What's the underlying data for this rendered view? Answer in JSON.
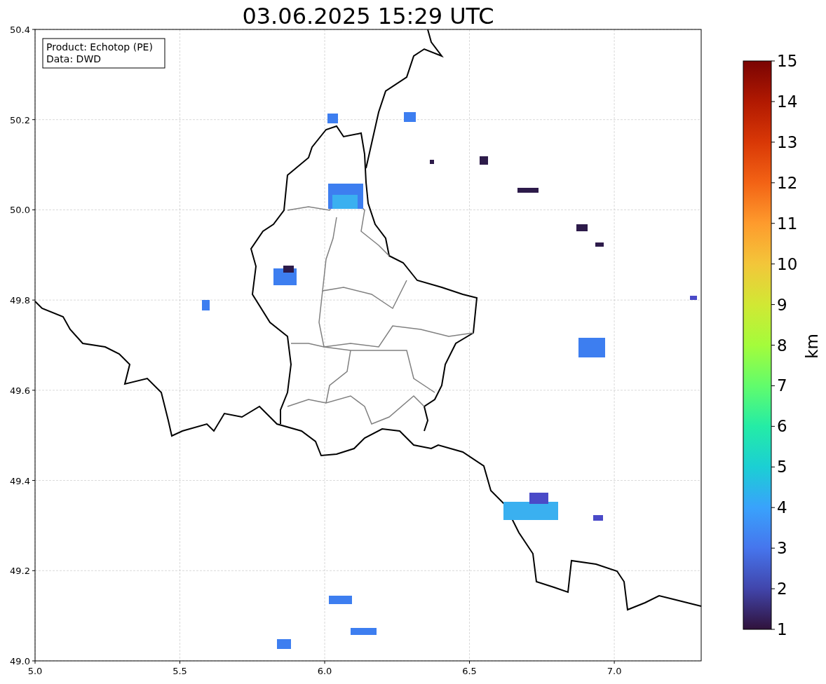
{
  "figure": {
    "title": "03.06.2025 15:29 UTC",
    "info_box": [
      "Product: Echotop (PE)",
      "Data: DWD"
    ],
    "xticks": [
      "5.0",
      "5.5",
      "6.0",
      "6.5",
      "7.0"
    ],
    "yticks": [
      "50.4",
      "50.2",
      "50.0",
      "49.8",
      "49.6",
      "49.4",
      "49.2",
      "49.0"
    ]
  },
  "colorbar": {
    "label": "km",
    "ticks": [
      "15",
      "14",
      "13",
      "12",
      "11",
      "10",
      "9",
      "8",
      "7",
      "6",
      "5",
      "4",
      "3",
      "2",
      "1"
    ]
  }
}
